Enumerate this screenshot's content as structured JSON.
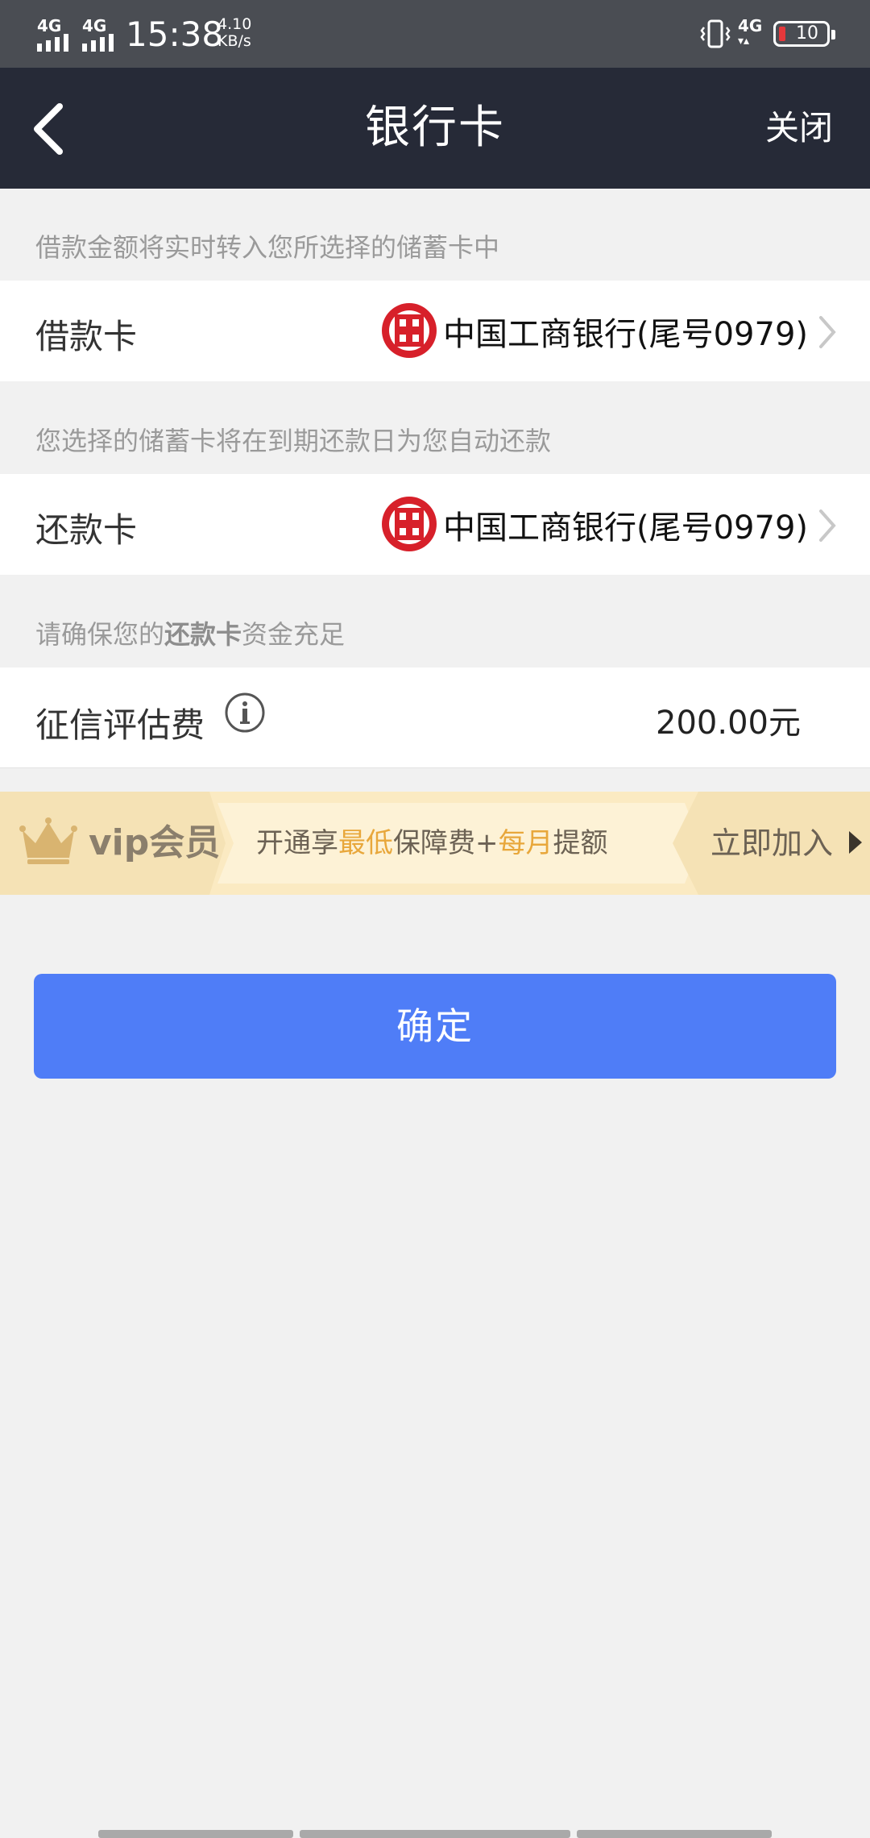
{
  "status_bar": {
    "signal1_label": "4G",
    "signal2_label": "4G",
    "time": "15:38",
    "net_speed_value": "4.10",
    "net_speed_unit": "KB/s",
    "signal3_label": "4G",
    "battery_level": "10"
  },
  "nav": {
    "title": "银行卡",
    "close_label": "关闭"
  },
  "section_loan": {
    "tip": "借款金额将实时转入您所选择的储蓄卡中",
    "label": "借款卡",
    "bank": "中国工商银行(尾号0979)"
  },
  "section_repay": {
    "tip": "您选择的储蓄卡将在到期还款日为您自动还款",
    "label": "还款卡",
    "bank": "中国工商银行(尾号0979)"
  },
  "section_fee": {
    "tip_prefix": "请确保您的",
    "tip_bold": "还款卡",
    "tip_suffix": "资金充足",
    "label": "征信评估费",
    "amount": "200.00元"
  },
  "vip": {
    "title": "vip会员",
    "desc_1": "开通享",
    "desc_hl_1": "最低",
    "desc_2": "保障费+",
    "desc_hl_2": "每月",
    "desc_3": "提额",
    "join_label": "立即加入"
  },
  "confirm_label": "确定",
  "colors": {
    "accent": "#4f7df7",
    "nav_bg": "#262a37",
    "icbc_red": "#d7202a",
    "vip_highlight": "#e8a73b"
  }
}
